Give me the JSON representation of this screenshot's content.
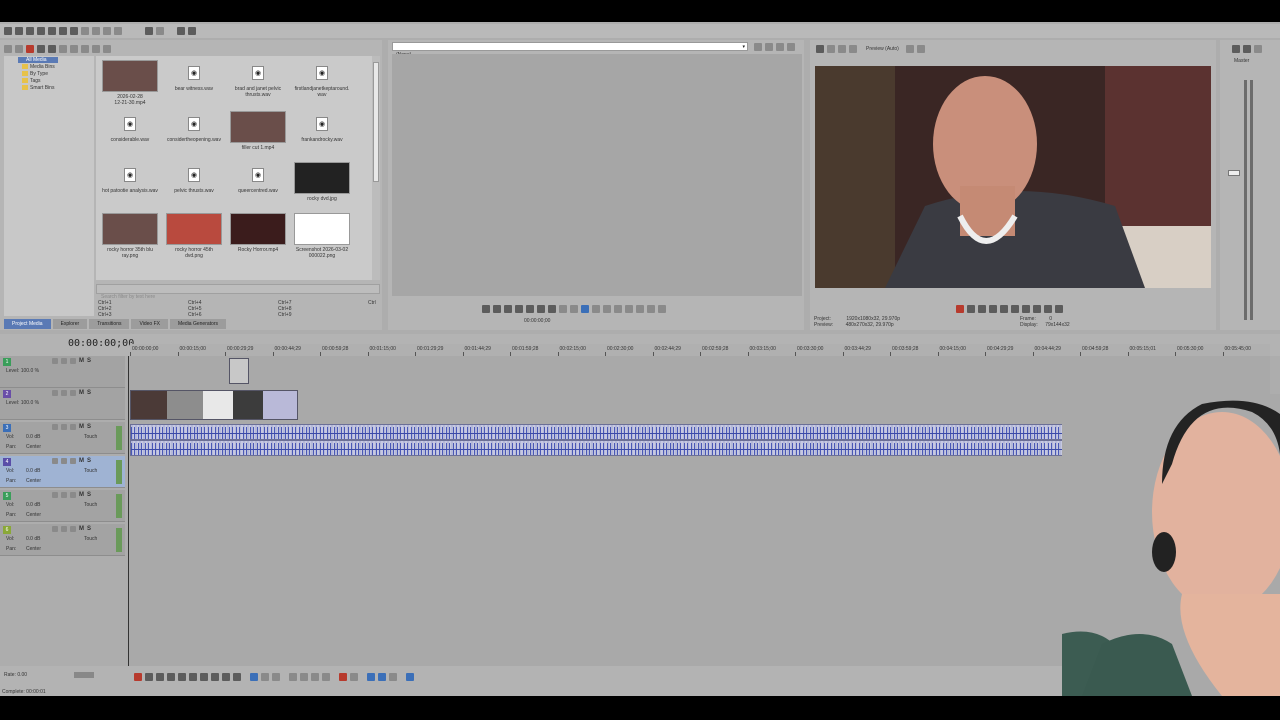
{
  "media_tree": {
    "items": [
      "All Media",
      "Media Bins",
      "By Type",
      "Tags",
      "Smart Bins"
    ]
  },
  "media_items": [
    {
      "name": "2026-02-28\n12-21-30.mp4",
      "kind": "video"
    },
    {
      "name": "bear witness.wav",
      "kind": "audio"
    },
    {
      "name": "brad and janet pelvic\nthrusts.wav",
      "kind": "audio"
    },
    {
      "name": "firstlandjanetkeptaround.\nwav",
      "kind": "audio"
    },
    {
      "name": "considerable.wav",
      "kind": "audio"
    },
    {
      "name": "considertheopening.wav",
      "kind": "audio"
    },
    {
      "name": "filler cut 1.mp4",
      "kind": "video"
    },
    {
      "name": "frankandrocky.wav",
      "kind": "audio"
    },
    {
      "name": "hot patootie analysis.wav",
      "kind": "audio"
    },
    {
      "name": "pelvic thrusts.wav",
      "kind": "audio"
    },
    {
      "name": "queercentred.wav",
      "kind": "audio"
    },
    {
      "name": "rocky dvd.jpg",
      "kind": "image"
    },
    {
      "name": "rocky horror 35th blu\nray.png",
      "kind": "image"
    },
    {
      "name": "rocky horror 45th\ndvd.png",
      "kind": "image"
    },
    {
      "name": "Rocky Horror.mp4",
      "kind": "video"
    },
    {
      "name": "Screenshot 2026-03-02\n000022.png",
      "kind": "image"
    }
  ],
  "media_search_placeholder": "Search filter by text here",
  "shortcuts": [
    "Ctrl+1",
    "Ctrl+2",
    "Ctrl+3",
    "Ctrl+4",
    "Ctrl+5",
    "Ctrl+6",
    "Ctrl+7",
    "Ctrl+8",
    "Ctrl+9",
    "Ctrl"
  ],
  "bottom_tabs": [
    "Project Media",
    "Explorer",
    "Transitions",
    "Video FX",
    "Media Generators"
  ],
  "trimmer": {
    "dropdown": "(None)",
    "time": "00:00:00;00"
  },
  "preview": {
    "label": "Preview (Auto)",
    "project_label": "Project:",
    "project_value": "1920x1080x32, 29.970p",
    "preview_label": "Preview:",
    "preview_value": "480x270x32, 29.970p",
    "frame_label": "Frame:",
    "frame_value": "0",
    "display_label": "Display:",
    "display_value": "79x144x32"
  },
  "master": {
    "label": "Master"
  },
  "timeline": {
    "timecode": "00:00:00;00",
    "ruler": [
      "00:00:00;00",
      "00:00:15;00",
      "00:00:29;29",
      "00:00:44;29",
      "00:00:59;28",
      "00:01:15;00",
      "00:01:29;29",
      "00:01:44;29",
      "00:01:59;28",
      "00:02:15;00",
      "00:02:30;00",
      "00:02:44;29",
      "00:02:59;28",
      "00:03:15;00",
      "00:03:30;00",
      "00:03:44;29",
      "00:03:59;28",
      "00:04:15;00",
      "00:04:29;29",
      "00:04:44;29",
      "00:04:59;28",
      "00:05:15;01",
      "00:05:30;00",
      "00:05:45;00"
    ],
    "tracks": [
      {
        "num": "1",
        "type": "video",
        "level": "Level: 100.0 %"
      },
      {
        "num": "2",
        "type": "video",
        "level": "Level: 100.0 %"
      },
      {
        "num": "3",
        "type": "audio",
        "vol": "Vol:",
        "vol_val": "0.0 dB",
        "pan": "Pan:",
        "pan_val": "Center",
        "mode": "Touch"
      },
      {
        "num": "4",
        "type": "audio",
        "vol": "Vol:",
        "vol_val": "0.0 dB",
        "pan": "Pan:",
        "pan_val": "Center",
        "mode": "Touch"
      },
      {
        "num": "5",
        "type": "audio",
        "vol": "Vol:",
        "vol_val": "0.0 dB",
        "pan": "Pan:",
        "pan_val": "Center",
        "mode": "Touch"
      },
      {
        "num": "6",
        "type": "audio",
        "vol": "Vol:",
        "vol_val": "0.0 dB",
        "pan": "Pan:",
        "pan_val": "Center",
        "mode": "Touch"
      }
    ],
    "mute": "M",
    "solo": "S"
  },
  "status": {
    "rate": "Rate: 0.00",
    "complete": "Complete: 00:00:01"
  },
  "colors": {
    "accent": "#5a7ab5",
    "record": "#b73a2d",
    "panel": "#adadad"
  }
}
